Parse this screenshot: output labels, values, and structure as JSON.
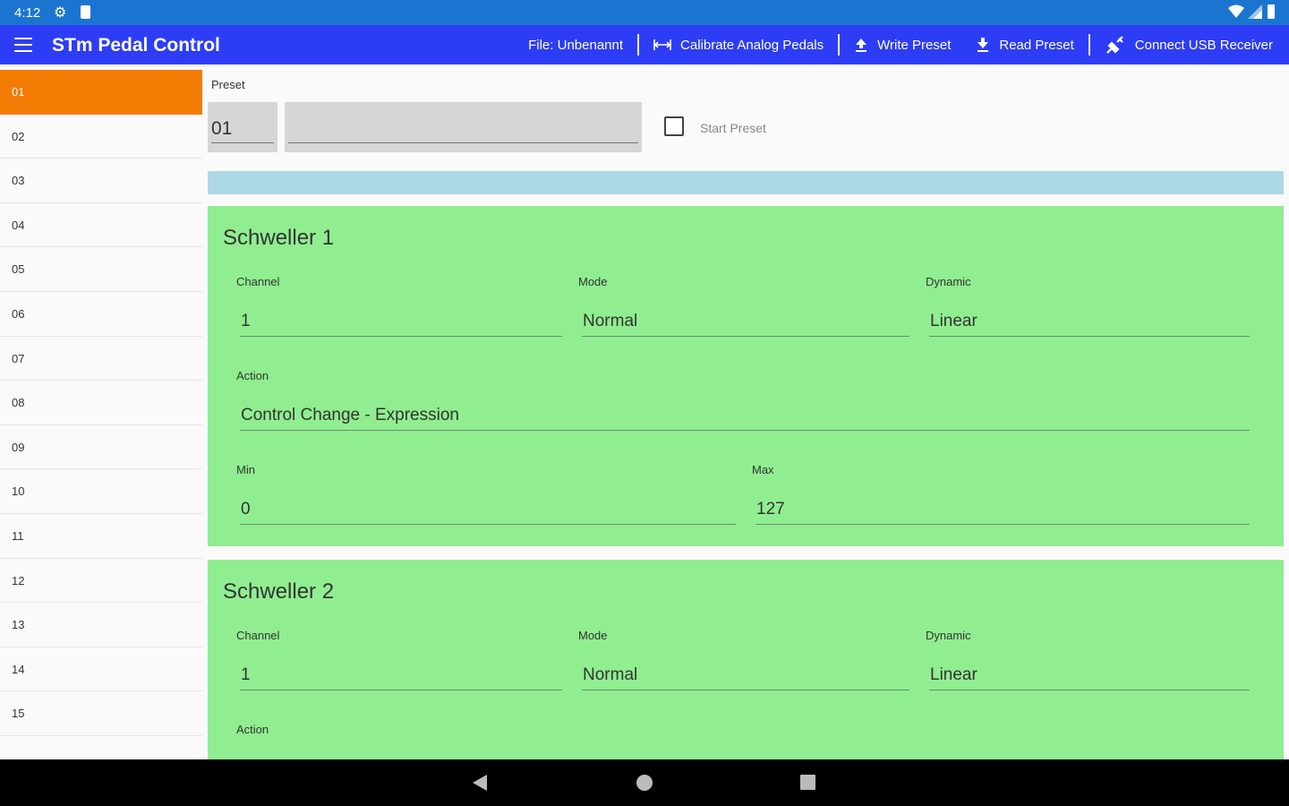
{
  "status_bar": {
    "time": "4:12"
  },
  "app_bar": {
    "title": "STm Pedal Control",
    "file_label": "File: Unbenannt",
    "calibrate_label": "Calibrate Analog Pedals",
    "write_label": "Write Preset",
    "read_label": "Read Preset",
    "connect_label": "Connect USB Receiver"
  },
  "preset_list": [
    "01",
    "02",
    "03",
    "04",
    "05",
    "06",
    "07",
    "08",
    "09",
    "10",
    "11",
    "12",
    "13",
    "14",
    "15"
  ],
  "preset": {
    "label": "Preset",
    "number": "01",
    "name": "",
    "start_preset_label": "Start Preset"
  },
  "cards": [
    {
      "title": "Schweller 1",
      "channel_label": "Channel",
      "channel": "1",
      "mode_label": "Mode",
      "mode": "Normal",
      "dynamic_label": "Dynamic",
      "dynamic": "Linear",
      "action_label": "Action",
      "action": "Control Change - Expression",
      "min_label": "Min",
      "min": "0",
      "max_label": "Max",
      "max": "127"
    },
    {
      "title": "Schweller 2",
      "channel_label": "Channel",
      "channel": "1",
      "mode_label": "Mode",
      "mode": "Normal",
      "dynamic_label": "Dynamic",
      "dynamic": "Linear",
      "action_label": "Action"
    }
  ],
  "colors": {
    "status_bar": "#1b75d0",
    "app_bar": "#2d3df5",
    "selected_item": "#f37c05",
    "card": "#90ee90",
    "info_bar": "#add8e6"
  },
  "icons": [
    "menu-icon",
    "settings-icon",
    "sd-card-icon",
    "wifi-icon",
    "cell-signal-icon",
    "battery-icon",
    "calibrate-icon",
    "upload-icon",
    "download-icon",
    "usb-icon",
    "back-icon",
    "home-icon",
    "recents-icon"
  ]
}
